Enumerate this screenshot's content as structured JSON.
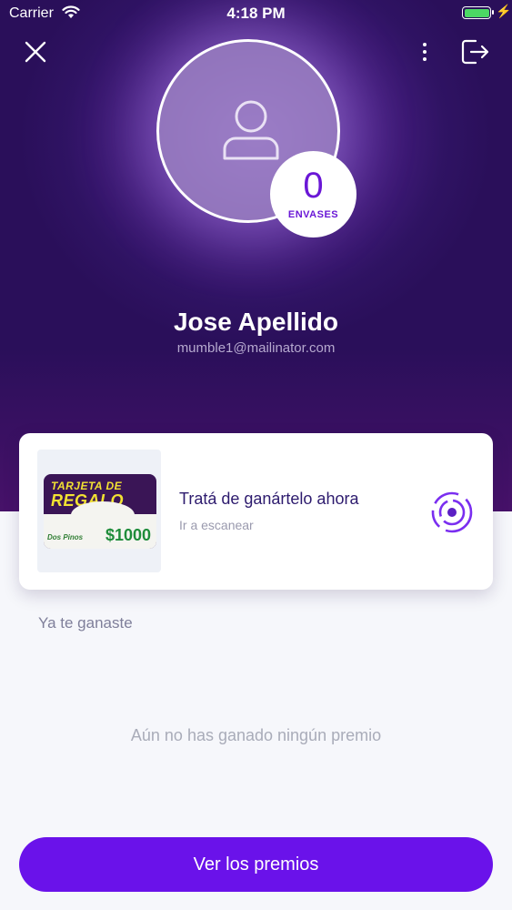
{
  "status_bar": {
    "carrier": "Carrier",
    "time": "4:18 PM",
    "wifi_icon": "wifi-icon",
    "battery_icon": "battery-icon"
  },
  "header": {
    "close_icon": "close-icon",
    "more_icon": "vertical-dots-icon",
    "logout_icon": "logout-icon"
  },
  "profile": {
    "avatar_icon": "user-icon",
    "containers_count": "0",
    "containers_label": "ENVASES",
    "name": "Jose Apellido",
    "email": "mumble1@mailinator.com"
  },
  "prize_card": {
    "image": {
      "title_line1": "TARJETA DE",
      "title_line2": "REGALO",
      "brand": "Dos Pinos",
      "amount": "$1000"
    },
    "title": "Tratá de ganártelo ahora",
    "subtitle": "Ir a escanear",
    "scan_icon": "scan-target-icon"
  },
  "won_section": {
    "label": "Ya te ganaste",
    "empty_message": "Aún no has ganado ningún premio"
  },
  "cta": {
    "label": "Ver los premios"
  },
  "colors": {
    "primary": "#6a12ea",
    "hero_dark": "#2a0f5a",
    "title_text": "#2d1b6e"
  }
}
